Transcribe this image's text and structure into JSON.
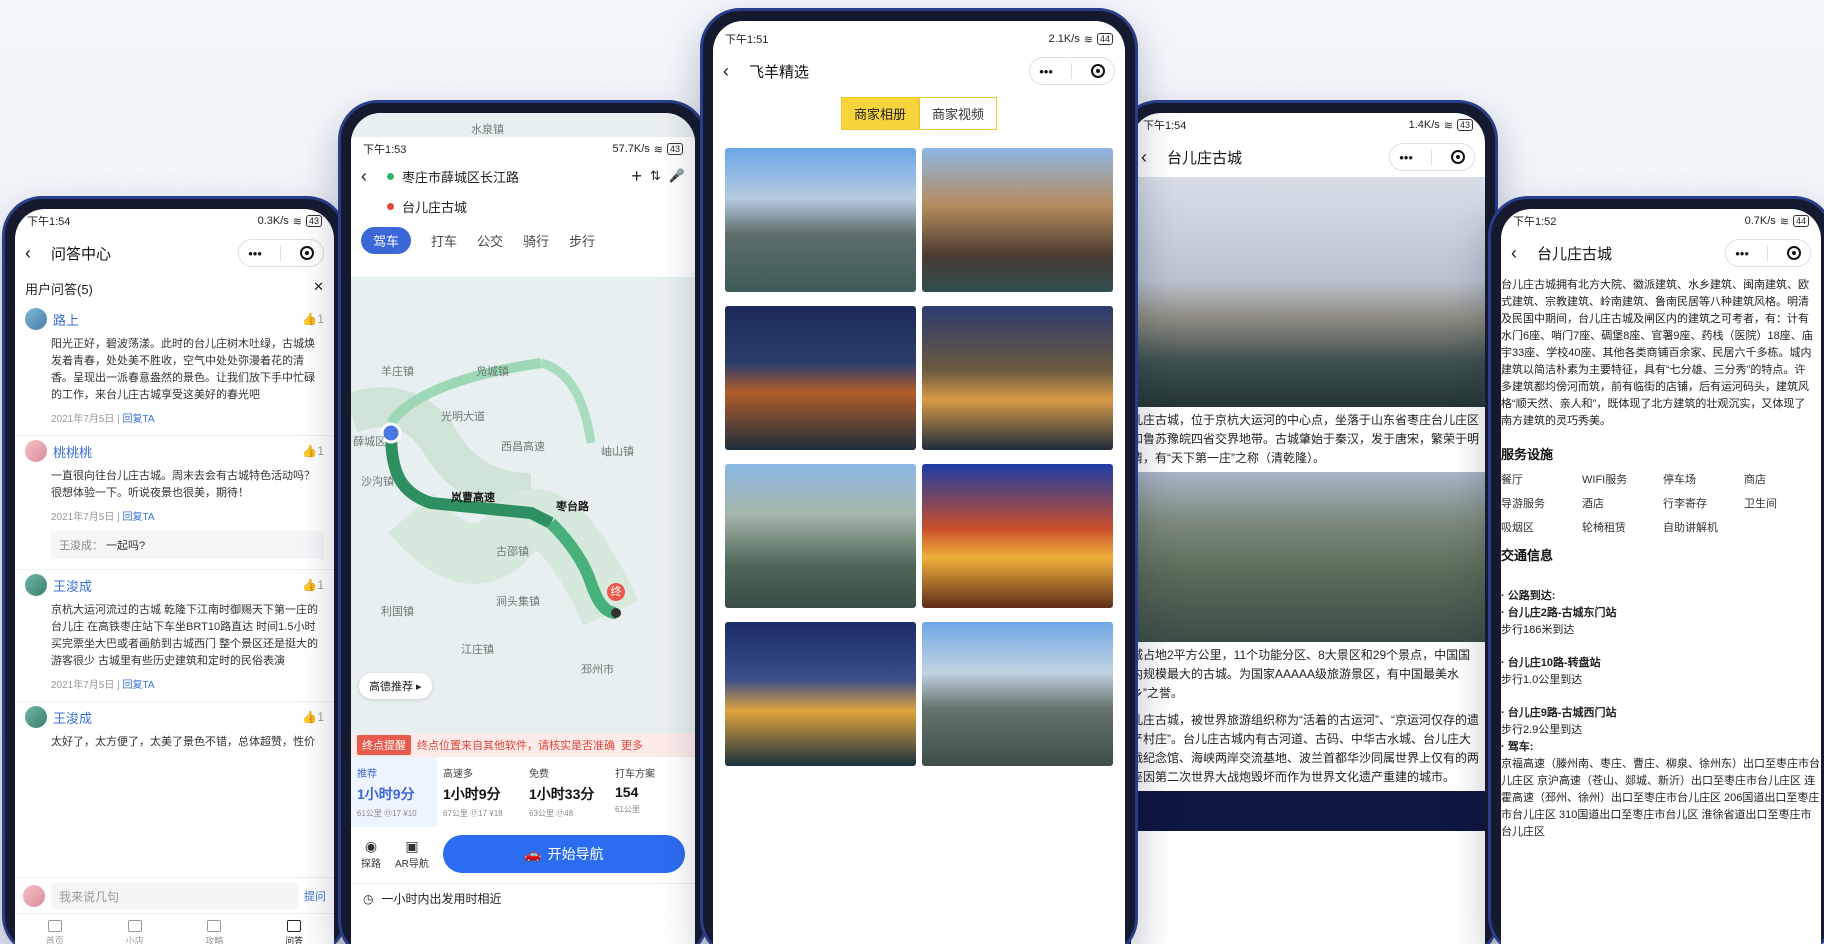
{
  "phone1": {
    "status_time": "下午1:54",
    "status_speed": "0.3K/s",
    "battery": "43",
    "title": "问答中心",
    "section": "用户问答(5)",
    "questions": [
      {
        "user": "路上",
        "text": "阳光正好，碧波荡漾。此时的台儿庄树木吐绿，古城焕发着青春，处处美不胜收，空气中处处弥漫着花的清香。呈现出一派春意盎然的景色。让我们放下手中忙碌的工作，来台儿庄古城享受这美好的春光吧",
        "date": "2021年7月5日",
        "reply_btn": "回复TA"
      },
      {
        "user": "桃桃桃",
        "text": "一直很向往台儿庄古城。周末去会有古城特色活动吗？很想体验一下。听说夜景也很美，期待！",
        "date": "2021年7月5日",
        "reply_btn": "回复TA",
        "reply_user": "王浚成：",
        "reply_text": "一起吗?"
      },
      {
        "user": "王浚成",
        "text": "京杭大运河流过的古城 乾隆下江南时御赐天下第一庄的台儿庄 在高铁枣庄站下车坐BRT10路直达 时间1.5小时 买完票坐大巴或者画舫到古城西门 整个景区还是挺大的 游客很少 古城里有些历史建筑和定时的民俗表演",
        "date": "2021年7月5日",
        "reply_btn": "回复TA"
      },
      {
        "user": "王浚成",
        "text": "太好了，太方便了，太美了景色不错，总体超赞，性价"
      }
    ],
    "ask_placeholder": "我来说几句",
    "ask_btn": "提问",
    "tabs": [
      "首页",
      "小店",
      "攻略",
      "问答"
    ]
  },
  "phone2": {
    "status_time": "下午1:53",
    "status_speed": "57.7K/s",
    "battery": "43",
    "from": "枣庄市薛城区长江路",
    "to": "台儿庄古城",
    "modes": [
      "驾车",
      "打车",
      "公交",
      "骑行",
      "步行"
    ],
    "map_labels": [
      "水泉镇",
      "羊庄镇",
      "凫城镇",
      "光明大道",
      "西昌高速",
      "岫山镇",
      "薛城区",
      "沙沟镇",
      "岚曹高速",
      "枣台路",
      "古邵镇",
      "涧头集镇",
      "利国镇",
      "江庄镇",
      "邳州市",
      "终"
    ],
    "recommend_btn": "高德推荐",
    "warn_tag": "终点提醒",
    "warn_text": "终点位置来自其他软件，请核实是否准确",
    "warn_more": "更多",
    "plans": [
      {
        "tag": "推荐",
        "time": "1小时9分",
        "sub": "61公里 ⑰17 ¥10"
      },
      {
        "tag": "高速多",
        "time": "1小时9分",
        "sub": "67公里 ⑰17 ¥18"
      },
      {
        "tag": "免费",
        "time": "1小时33分",
        "sub": "63公里 ⑰48"
      },
      {
        "tag": "打车方案",
        "time": "154",
        "sub": "61公里"
      }
    ],
    "tool1": "探路",
    "tool2": "AR导航",
    "start_btn": "开始导航",
    "hint": "一小时内出发用时相近"
  },
  "phone3": {
    "status_time": "下午1:51",
    "status_speed": "2.1K/s",
    "battery": "44",
    "title": "飞羊精选",
    "seg_on": "商家相册",
    "seg_off": "商家视频"
  },
  "phone4": {
    "status_time": "下午1:54",
    "status_speed": "1.4K/s",
    "battery": "43",
    "title": "台儿庄古城",
    "p1": "儿庄古城，位于京杭大运河的中心点，坐落于山东省枣庄台儿庄区和鲁苏豫皖四省交界地带。古城肇始于秦汉，发于唐宋，繁荣于明清，有“天下第一庄”之称（清乾隆）。",
    "p2": "城占地2平方公里，11个功能分区、8大景区和29个景点，中国国内规模最大的古城。为国家AAAAA级旅游景区，有中国最美水乡”之誉。",
    "p3": "儿庄古城，被世界旅游组织称为“活着的古运河”、“京运河仅存的遗产村庄”。台儿庄古城内有古河道、古码、中华古水城、台儿庄大战纪念馆、海峡两岸交流基地、波兰首都华沙同属世界上仅有的两座因第二次世界大战炮毁坏而作为世界文化遗产重建的城市。"
  },
  "phone5": {
    "status_time": "下午1:52",
    "status_speed": "0.7K/s",
    "battery": "44",
    "title": "台儿庄古城",
    "intro": "台儿庄古城拥有北方大院、徽派建筑、水乡建筑、闽南建筑、欧式建筑、宗教建筑、岭南建筑、鲁南民居等八种建筑风格。明清及民国中期间，台儿庄古城及闸区内的建筑之可考者，有：计有水门6座、哨门7座、碉堡8座、官署9座、药栈（医院）18座、庙宇33座、学校40座、其他各类商铺百余家、民居六千多栋。城内建筑以简洁朴素为主要特征，具有“七分雄、三分秀”的特点。许多建筑都均傍河而筑，前有临街的店铺，后有运河码头，建筑风格“顺天然、亲人和”，既体现了北方建筑的壮观沉实，又体现了南方建筑的灵巧秀美。",
    "svc_title": "服务设施",
    "facilities": [
      "餐厅",
      "WIFI服务",
      "停车场",
      "商店",
      "导游服务",
      "酒店",
      "行李寄存",
      "卫生间",
      "吸烟区",
      "轮椅租赁",
      "自助讲解机"
    ],
    "traffic_title": "交通信息",
    "t1": "· 公路到达:",
    "t2": "· 台儿庄2路-古城东门站",
    "t3": "步行186米到达",
    "t4": "· 台儿庄10路-转盘站",
    "t5": "步行1.0公里到达",
    "t6": "· 台儿庄9路-古城西门站",
    "t7": "步行2.9公里到达",
    "t8": "· 驾车:",
    "t9": "京福高速（滕州南、枣庄、曹庄、柳泉、徐州东）出口至枣庄市台儿庄区 京沪高速（苍山、郯城、新沂）出口至枣庄市台儿庄区 连霍高速（邳州、徐州）出口至枣庄市台儿庄区 206国道出口至枣庄市台儿庄区 310国道出口至枣庄市台儿区 淮徐省道出口至枣庄市台儿庄区"
  }
}
